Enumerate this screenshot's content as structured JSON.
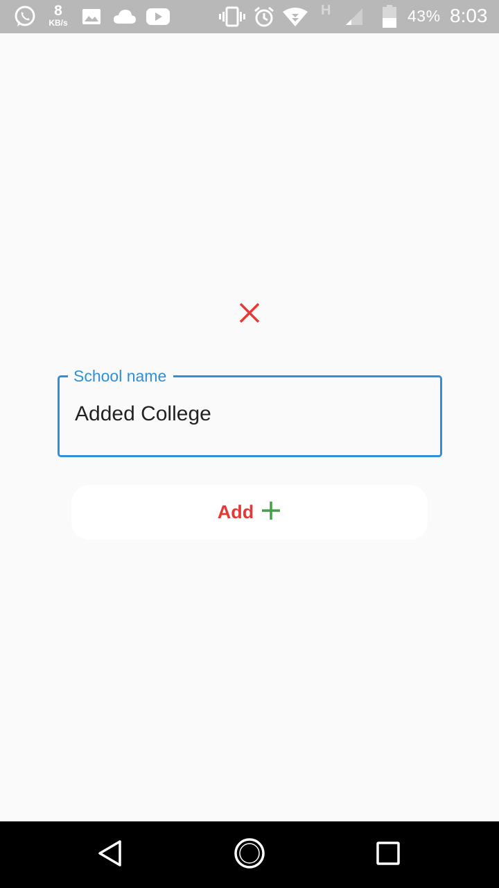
{
  "status_bar": {
    "network_speed_value": "8",
    "network_speed_unit": "KB/s",
    "network_type": "H",
    "battery_percent": "43%",
    "time": "8:03",
    "icons": [
      "whatsapp-icon",
      "image-icon",
      "cloud-icon",
      "youtube-icon",
      "vibrate-icon",
      "alarm-icon",
      "wifi-icon",
      "signal-icon",
      "battery-icon"
    ]
  },
  "form": {
    "field_label": "School name",
    "field_value": "Added College",
    "add_button_label": "Add",
    "close_icon": "close-icon",
    "plus_icon": "plus-icon"
  },
  "nav_bar": {
    "icons": [
      "back-icon",
      "home-icon",
      "recents-icon"
    ]
  },
  "colors": {
    "accent": "#2f8fd8",
    "danger": "#e53935",
    "success": "#43a047",
    "status_bar_bg": "#b8b8b8",
    "page_bg": "#fafafa"
  }
}
